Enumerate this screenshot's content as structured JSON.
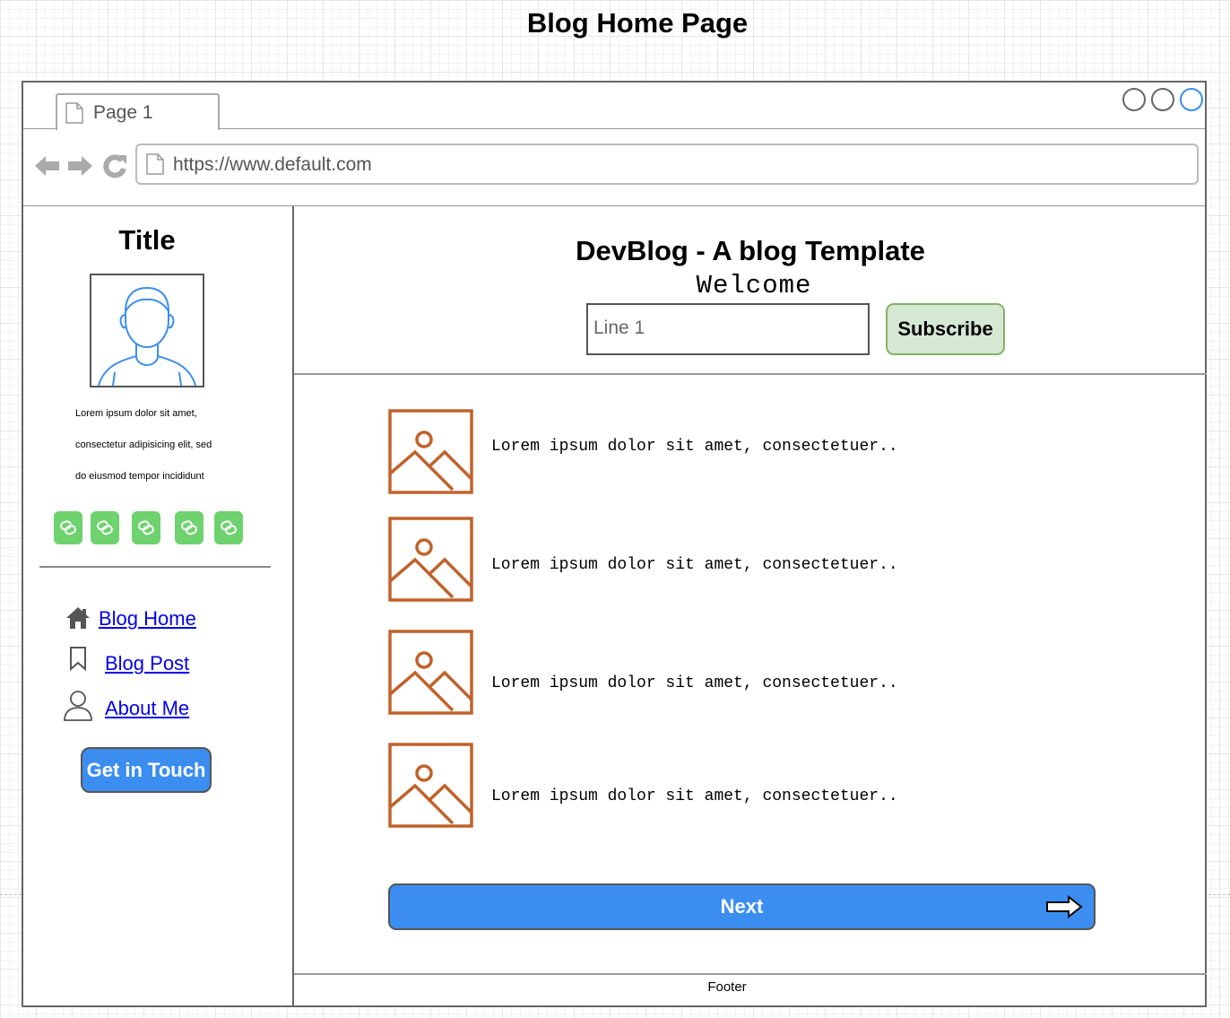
{
  "page": {
    "heading": "Blog Home Page"
  },
  "browser": {
    "tab_label": "Page 1",
    "url": "https://www.default.com",
    "window_controls": [
      "minimize-circle",
      "maximize-circle",
      "close-circle"
    ]
  },
  "sidebar": {
    "title": "Title",
    "bio_lines": [
      "Lorem ipsum dolor sit amet,",
      "consectetur adipisicing elit, sed",
      "do eiusmod tempor incididunt"
    ],
    "social_links": [
      "link-icon",
      "link-icon",
      "link-icon",
      "link-icon",
      "link-icon"
    ],
    "nav": [
      {
        "label": "Blog Home",
        "icon": "home-icon"
      },
      {
        "label": "Blog Post",
        "icon": "bookmark-icon"
      },
      {
        "label": "About Me",
        "icon": "user-icon"
      }
    ],
    "cta_label": "Get in Touch"
  },
  "header": {
    "title": "DevBlog - A blog Template",
    "subtitle": "Welcome",
    "input_value": "Line 1",
    "subscribe_label": "Subscribe"
  },
  "posts": [
    {
      "excerpt": "Lorem ipsum dolor sit amet, consectetuer.."
    },
    {
      "excerpt": "Lorem ipsum dolor sit amet, consectetuer.."
    },
    {
      "excerpt": "Lorem ipsum dolor sit amet, consectetuer.."
    },
    {
      "excerpt": "Lorem ipsum dolor sit amet, consectetuer.."
    }
  ],
  "pagination": {
    "next_label": "Next"
  },
  "footer": {
    "text": "Footer"
  },
  "colors": {
    "primary_button": "#3b8ef0",
    "subscribe_fill": "#d5e8d4",
    "subscribe_border": "#82b366",
    "social_icon_fill": "#6ed26e",
    "thumbnail_stroke": "#c0622b",
    "avatar_stroke": "#3b8ef0"
  }
}
